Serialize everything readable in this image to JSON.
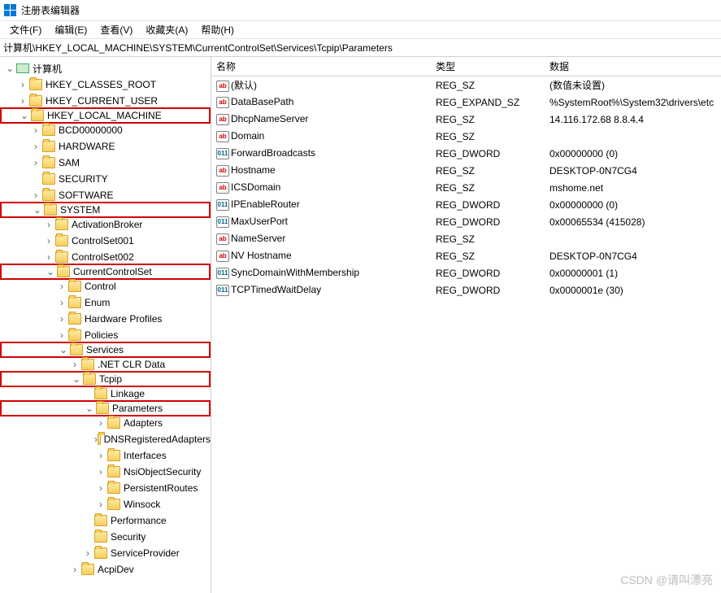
{
  "title": "注册表编辑器",
  "menus": [
    "文件(F)",
    "编辑(E)",
    "查看(V)",
    "收藏夹(A)",
    "帮助(H)"
  ],
  "address": "计算机\\HKEY_LOCAL_MACHINE\\SYSTEM\\CurrentControlSet\\Services\\Tcpip\\Parameters",
  "cols": {
    "name": "名称",
    "type": "类型",
    "data": "数据"
  },
  "root": "计算机",
  "hives": {
    "hkcr": "HKEY_CLASSES_ROOT",
    "hkcu": "HKEY_CURRENT_USER",
    "hklm": "HKEY_LOCAL_MACHINE",
    "bcd": "BCD00000000",
    "hw": "HARDWARE",
    "sam": "SAM",
    "sec": "SECURITY",
    "sw": "SOFTWARE",
    "sys": "SYSTEM",
    "ab": "ActivationBroker",
    "cs001": "ControlSet001",
    "cs002": "ControlSet002",
    "ccs": "CurrentControlSet",
    "ctrl": "Control",
    "enum": "Enum",
    "hwp": "Hardware Profiles",
    "pol": "Policies",
    "svcs": "Services",
    "netclr": ".NET CLR Data",
    "tcpip": "Tcpip",
    "link": "Linkage",
    "params": "Parameters",
    "adp": "Adapters",
    "dns": "DNSRegisteredAdapters",
    "ifc": "Interfaces",
    "nsi": "NsiObjectSecurity",
    "pr": "PersistentRoutes",
    "ws": "Winsock",
    "perf": "Performance",
    "secu": "Security",
    "sp": "ServiceProvider",
    "acpi": "AcpiDev"
  },
  "values": [
    {
      "n": "(默认)",
      "t": "REG_SZ",
      "d": "(数值未设置)",
      "k": "s"
    },
    {
      "n": "DataBasePath",
      "t": "REG_EXPAND_SZ",
      "d": "%SystemRoot%\\System32\\drivers\\etc",
      "k": "s"
    },
    {
      "n": "DhcpNameServer",
      "t": "REG_SZ",
      "d": "14.116.172.68 8.8.4.4",
      "k": "s"
    },
    {
      "n": "Domain",
      "t": "REG_SZ",
      "d": "",
      "k": "s"
    },
    {
      "n": "ForwardBroadcasts",
      "t": "REG_DWORD",
      "d": "0x00000000 (0)",
      "k": "b"
    },
    {
      "n": "Hostname",
      "t": "REG_SZ",
      "d": "DESKTOP-0N7CG4",
      "k": "s"
    },
    {
      "n": "ICSDomain",
      "t": "REG_SZ",
      "d": "mshome.net",
      "k": "s"
    },
    {
      "n": "IPEnableRouter",
      "t": "REG_DWORD",
      "d": "0x00000000 (0)",
      "k": "b"
    },
    {
      "n": "MaxUserPort",
      "t": "REG_DWORD",
      "d": "0x00065534 (415028)",
      "k": "b"
    },
    {
      "n": "NameServer",
      "t": "REG_SZ",
      "d": "",
      "k": "s"
    },
    {
      "n": "NV Hostname",
      "t": "REG_SZ",
      "d": "DESKTOP-0N7CG4",
      "k": "s"
    },
    {
      "n": "SyncDomainWithMembership",
      "t": "REG_DWORD",
      "d": "0x00000001 (1)",
      "k": "b"
    },
    {
      "n": "TCPTimedWaitDelay",
      "t": "REG_DWORD",
      "d": "0x0000001e (30)",
      "k": "b"
    }
  ],
  "watermark": "CSDN @请叫漂亮"
}
